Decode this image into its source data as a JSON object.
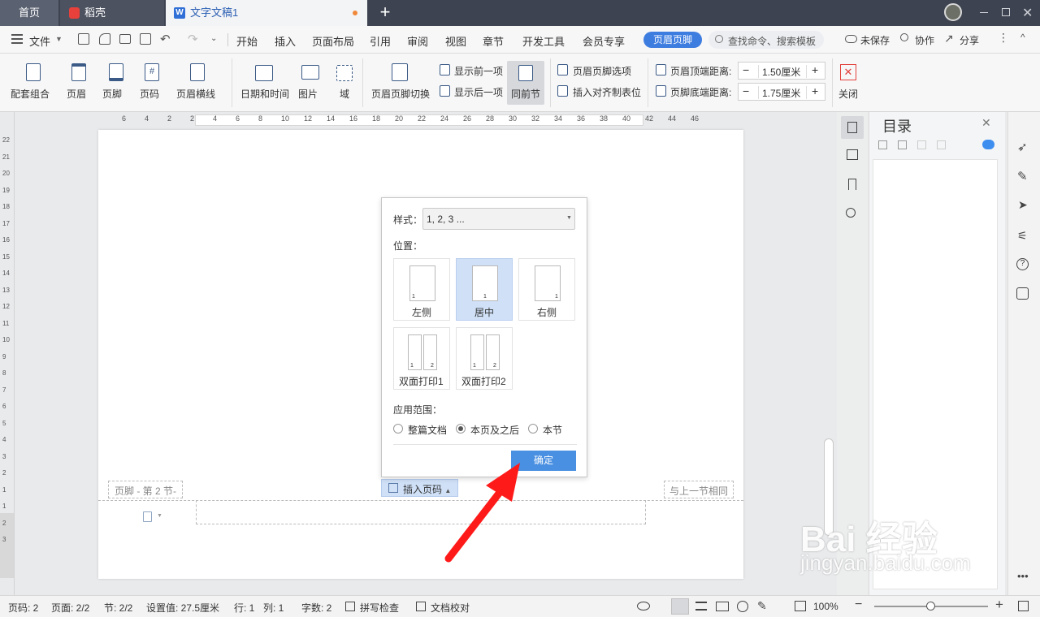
{
  "tabs": {
    "home": "首页",
    "daoke": "稻壳",
    "doc": "文字文稿1"
  },
  "menu": {
    "file": "文件",
    "items": [
      "开始",
      "插入",
      "页面布局",
      "引用",
      "审阅",
      "视图",
      "章节",
      "开发工具",
      "会员专享"
    ],
    "active": "页眉页脚",
    "search": "查找命令、搜索模板",
    "unsaved": "未保存",
    "collab": "协作",
    "share": "分享"
  },
  "ribbon": {
    "combo": "配套组合",
    "header": "页眉",
    "footer": "页脚",
    "pagenum": "页码",
    "headerline": "页眉横线",
    "datetime": "日期和时间",
    "picture": "图片",
    "field": "域",
    "switch": "页眉页脚切换",
    "prev": "显示前一项",
    "next": "显示后一项",
    "same": "同前节",
    "options": "页眉页脚选项",
    "align": "插入对齐制表位",
    "top_dist_label": "页眉顶端距离:",
    "top_dist": "1.50厘米",
    "bottom_dist_label": "页脚底端距离:",
    "bottom_dist": "1.75厘米",
    "close": "关闭"
  },
  "ruler_h": [
    "6",
    "4",
    "2",
    "2",
    "4",
    "6",
    "8",
    "10",
    "12",
    "14",
    "16",
    "18",
    "20",
    "22",
    "24",
    "26",
    "28",
    "30",
    "32",
    "34",
    "36",
    "38",
    "40",
    "42",
    "44",
    "46"
  ],
  "ruler_v": [
    "22",
    "21",
    "20",
    "19",
    "18",
    "17",
    "16",
    "15",
    "14",
    "13",
    "12",
    "11",
    "10",
    "9",
    "8",
    "7",
    "6",
    "5",
    "4",
    "3",
    "2",
    "1",
    "1",
    "2",
    "3"
  ],
  "doc": {
    "footer_tag": "页脚 - 第 2 节-",
    "insert_pagenum": "插入页码",
    "same_as_prev": "与上一节相同"
  },
  "dialog": {
    "style_label": "样式：",
    "style_value": "1, 2, 3 ...",
    "position_label": "位置：",
    "left": "左侧",
    "center": "居中",
    "right": "右侧",
    "duplex1": "双面打印1",
    "duplex2": "双面打印2",
    "scope_label": "应用范围：",
    "scope_all": "整篇文档",
    "scope_after": "本页及之后",
    "scope_section": "本节",
    "ok": "确定"
  },
  "panel": {
    "title": "目录"
  },
  "status": {
    "page": "页码: 2",
    "pages": "页面: 2/2",
    "section": "节: 2/2",
    "setting": "设置值: 27.5厘米",
    "row": "行: 1",
    "col": "列: 1",
    "words": "字数: 2",
    "spell": "拼写检查",
    "proof": "文档校对",
    "zoom": "100%"
  },
  "watermark": {
    "text": "Bai 经验",
    "url": "jingyan.baidu.com"
  }
}
